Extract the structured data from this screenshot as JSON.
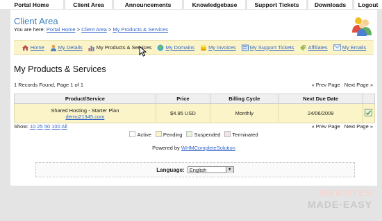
{
  "top_nav": [
    "Portal Home",
    "Client Area",
    "Announcements",
    "Knowledgebase",
    "Support Tickets",
    "Downloads",
    "Logout"
  ],
  "header": {
    "title": "Client Area",
    "breadcrumb_prefix": "You are here:",
    "breadcrumb": [
      "Portal Home",
      "Client Area",
      "My Products & Services"
    ],
    "breadcrumb_sep": ">"
  },
  "sub_nav": [
    {
      "label": "Home",
      "icon": "home-icon",
      "color": "#c0504d"
    },
    {
      "label": "My Details",
      "icon": "user-icon",
      "color": "#4f81bd"
    },
    {
      "label": "My Products & Services",
      "icon": "bar-chart-icon",
      "color": "#8064a2"
    },
    {
      "label": "My Domains",
      "icon": "globe-icon",
      "color": "#4bacc6"
    },
    {
      "label": "My Invoices",
      "icon": "coins-icon",
      "color": "#f2c200"
    },
    {
      "label": "My Support Tickets",
      "icon": "ticket-icon",
      "color": "#4f81bd"
    },
    {
      "label": "Affiliates",
      "icon": "tag-icon",
      "color": "#9bbb59"
    },
    {
      "label": "My Emails",
      "icon": "email-icon",
      "color": "#7f9fcf"
    }
  ],
  "page_title": "My Products & Services",
  "records_text": "1 Records Found, Page 1 of 1",
  "pager": {
    "prev": "« Prev Page",
    "next": "Next Page »"
  },
  "table": {
    "headers": [
      "Product/Service",
      "Price",
      "Billing Cycle",
      "Next Due Date"
    ],
    "rows": [
      {
        "product": "Shared Hosting - Starter Plan",
        "domain": "demo21345.com",
        "price": "$4.95 USD",
        "billing": "Monthly",
        "due": "24/06/2009"
      }
    ]
  },
  "show": {
    "label": "Show:",
    "options": [
      "10",
      "25",
      "50",
      "100",
      "All"
    ]
  },
  "legend": [
    {
      "label": "Active",
      "color": "#ffffff"
    },
    {
      "label": "Pending",
      "color": "#fbf4c8"
    },
    {
      "label": "Suspended",
      "color": "#e9f5dc"
    },
    {
      "label": "Terminated",
      "color": "#f6e2e2"
    }
  ],
  "powered": {
    "prefix": "Powered by",
    "link": "WHMCompleteSolution"
  },
  "language": {
    "label": "Language:",
    "value": "English"
  },
  "watermark": {
    "line1": "WEBSITES",
    "line2": "MADE·EASY"
  }
}
